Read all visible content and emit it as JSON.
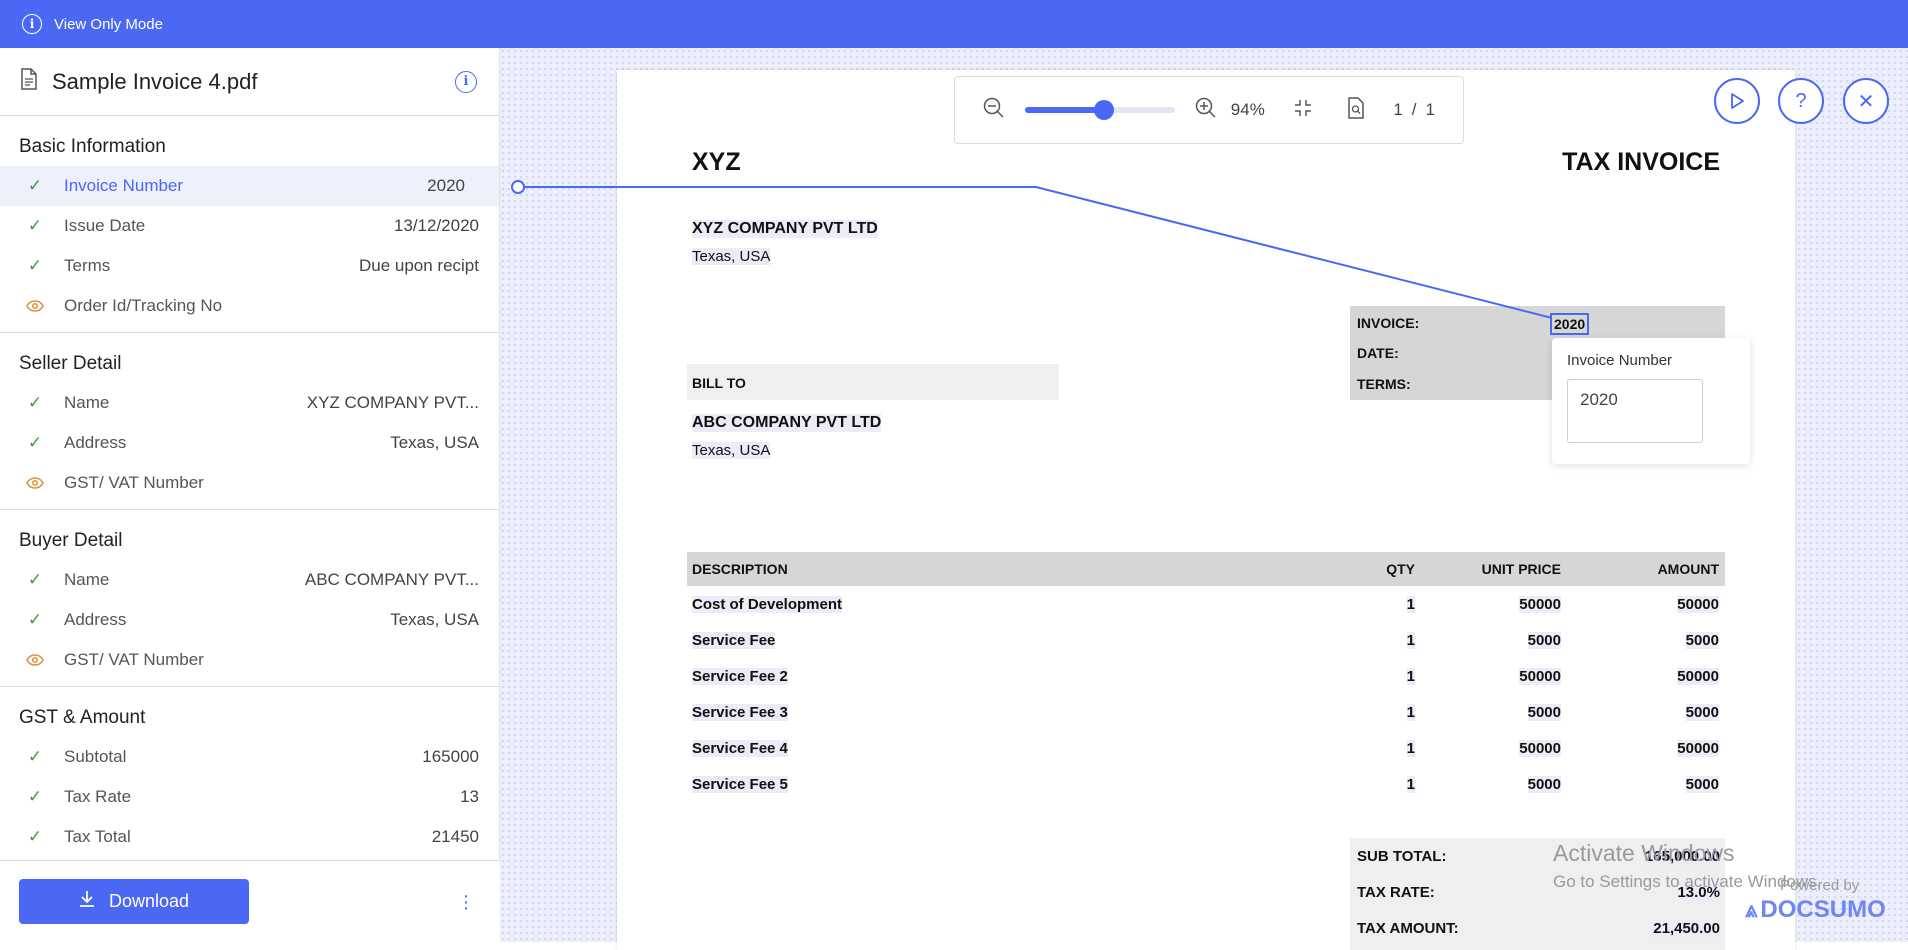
{
  "topbar": {
    "mode_label": "View Only Mode"
  },
  "sidebar": {
    "doc_title": "Sample Invoice 4.pdf",
    "sections": [
      {
        "title": "Basic Information",
        "fields": [
          {
            "label": "Invoice Number",
            "value": "2020",
            "status": "check"
          },
          {
            "label": "Issue Date",
            "value": "13/12/2020",
            "status": "check"
          },
          {
            "label": "Terms",
            "value": "Due upon recipt",
            "status": "check"
          },
          {
            "label": "Order Id/Tracking No",
            "value": "",
            "status": "eye"
          }
        ]
      },
      {
        "title": "Seller Detail",
        "fields": [
          {
            "label": "Name",
            "value": "XYZ COMPANY PVT...",
            "status": "check"
          },
          {
            "label": "Address",
            "value": "Texas, USA",
            "status": "check"
          },
          {
            "label": "GST/ VAT Number",
            "value": "",
            "status": "eye"
          }
        ]
      },
      {
        "title": "Buyer Detail",
        "fields": [
          {
            "label": "Name",
            "value": "ABC COMPANY PVT...",
            "status": "check"
          },
          {
            "label": "Address",
            "value": "Texas, USA",
            "status": "check"
          },
          {
            "label": "GST/ VAT Number",
            "value": "",
            "status": "eye"
          }
        ]
      },
      {
        "title": "GST & Amount",
        "fields": [
          {
            "label": "Subtotal",
            "value": "165000",
            "status": "check"
          },
          {
            "label": "Tax Rate",
            "value": "13",
            "status": "check"
          },
          {
            "label": "Tax Total",
            "value": "21450",
            "status": "check"
          }
        ]
      }
    ],
    "download_label": "Download"
  },
  "viewer": {
    "zoom": "94%",
    "zoom_fraction": 0.53,
    "page_current": "1",
    "page_sep": "/",
    "page_total": "1"
  },
  "invoice": {
    "company": "XYZ",
    "doc_type": "TAX INVOICE",
    "seller_name": "XYZ COMPANY PVT LTD",
    "seller_address": "Texas, USA",
    "invoice_label": "INVOICE:",
    "invoice_value": "2020",
    "date_label": "DATE:",
    "terms_label": "TERMS:",
    "bill_to": "BILL TO",
    "buyer_name": "ABC COMPANY PVT LTD",
    "buyer_address": "Texas, USA",
    "headers": {
      "desc": "DESCRIPTION",
      "qty": "QTY",
      "price": "UNIT PRICE",
      "amount": "AMOUNT"
    },
    "items": [
      {
        "desc": "Cost of Development",
        "qty": "1",
        "price": "50000",
        "amount": "50000"
      },
      {
        "desc": "Service Fee",
        "qty": "1",
        "price": "5000",
        "amount": "5000"
      },
      {
        "desc": "Service Fee 2",
        "qty": "1",
        "price": "50000",
        "amount": "50000"
      },
      {
        "desc": "Service Fee 3",
        "qty": "1",
        "price": "5000",
        "amount": "5000"
      },
      {
        "desc": "Service Fee 4",
        "qty": "1",
        "price": "50000",
        "amount": "50000"
      },
      {
        "desc": "Service Fee 5",
        "qty": "1",
        "price": "5000",
        "amount": "5000"
      }
    ],
    "subtotal_label": "SUB TOTAL:",
    "subtotal_value": "165,000.00",
    "taxrate_label": "TAX RATE:",
    "taxrate_value": "13.0%",
    "taxamount_label": "TAX AMOUNT:",
    "taxamount_value": "21,450.00"
  },
  "popup": {
    "label": "Invoice Number",
    "value": "2020"
  },
  "watermark": {
    "line1": "Activate Windows",
    "line2": "Go to Settings to activate Windows.",
    "powered": "Powered by",
    "brand": "DOCSUMO"
  },
  "colors": {
    "accent": "#4b68f4",
    "check": "#3a9a46",
    "eye": "#e0903a"
  }
}
